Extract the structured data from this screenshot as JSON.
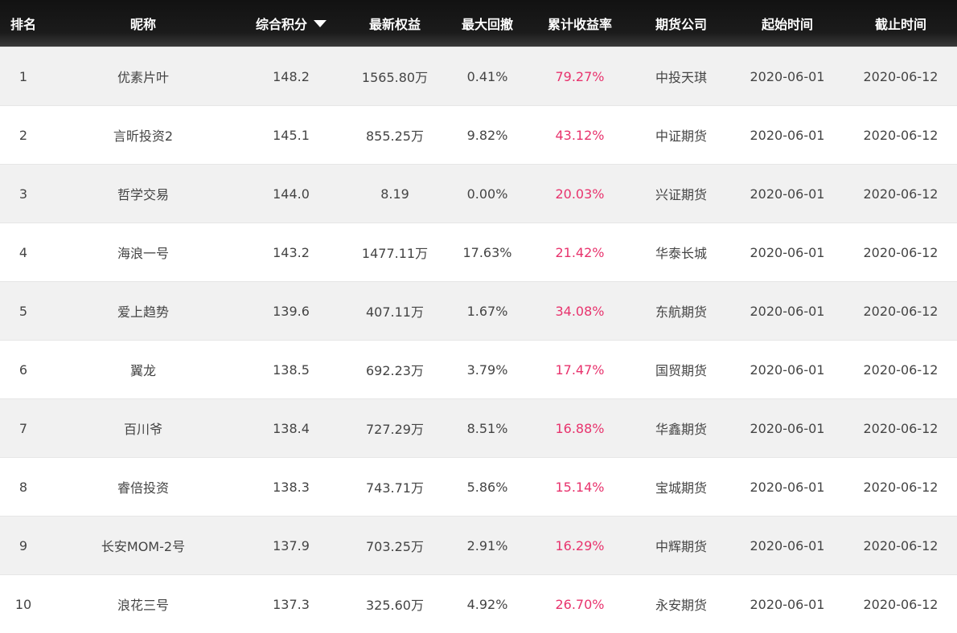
{
  "header": {
    "rank": "排名",
    "nickname": "昵称",
    "score": "综合积分",
    "equity": "最新权益",
    "drawdown": "最大回撤",
    "return": "累计收益率",
    "broker": "期货公司",
    "start": "起始时间",
    "end": "截止时间",
    "sort_icon": "sort-desc-triangle"
  },
  "colors": {
    "header_bg": "#121212",
    "row_alt_bg": "#f1f1f1",
    "return_text": "#e8336d",
    "body_text": "#444444"
  },
  "rows": [
    {
      "rank": "1",
      "nickname": "优素片叶",
      "score": "148.2",
      "equity": "1565.80万",
      "drawdown": "0.41%",
      "return": "79.27%",
      "broker": "中投天琪",
      "start": "2020-06-01",
      "end": "2020-06-12"
    },
    {
      "rank": "2",
      "nickname": "言昕投资2",
      "score": "145.1",
      "equity": "855.25万",
      "drawdown": "9.82%",
      "return": "43.12%",
      "broker": "中证期货",
      "start": "2020-06-01",
      "end": "2020-06-12"
    },
    {
      "rank": "3",
      "nickname": "哲学交易",
      "score": "144.0",
      "equity": "8.19",
      "drawdown": "0.00%",
      "return": "20.03%",
      "broker": "兴证期货",
      "start": "2020-06-01",
      "end": "2020-06-12"
    },
    {
      "rank": "4",
      "nickname": "海浪一号",
      "score": "143.2",
      "equity": "1477.11万",
      "drawdown": "17.63%",
      "return": "21.42%",
      "broker": "华泰长城",
      "start": "2020-06-01",
      "end": "2020-06-12"
    },
    {
      "rank": "5",
      "nickname": "爱上趋势",
      "score": "139.6",
      "equity": "407.11万",
      "drawdown": "1.67%",
      "return": "34.08%",
      "broker": "东航期货",
      "start": "2020-06-01",
      "end": "2020-06-12"
    },
    {
      "rank": "6",
      "nickname": "翼龙",
      "score": "138.5",
      "equity": "692.23万",
      "drawdown": "3.79%",
      "return": "17.47%",
      "broker": "国贸期货",
      "start": "2020-06-01",
      "end": "2020-06-12"
    },
    {
      "rank": "7",
      "nickname": "百川爷",
      "score": "138.4",
      "equity": "727.29万",
      "drawdown": "8.51%",
      "return": "16.88%",
      "broker": "华鑫期货",
      "start": "2020-06-01",
      "end": "2020-06-12"
    },
    {
      "rank": "8",
      "nickname": "睿倍投资",
      "score": "138.3",
      "equity": "743.71万",
      "drawdown": "5.86%",
      "return": "15.14%",
      "broker": "宝城期货",
      "start": "2020-06-01",
      "end": "2020-06-12"
    },
    {
      "rank": "9",
      "nickname": "长安MOM-2号",
      "score": "137.9",
      "equity": "703.25万",
      "drawdown": "2.91%",
      "return": "16.29%",
      "broker": "中辉期货",
      "start": "2020-06-01",
      "end": "2020-06-12"
    },
    {
      "rank": "10",
      "nickname": "浪花三号",
      "score": "137.3",
      "equity": "325.60万",
      "drawdown": "4.92%",
      "return": "26.70%",
      "broker": "永安期货",
      "start": "2020-06-01",
      "end": "2020-06-12"
    }
  ]
}
